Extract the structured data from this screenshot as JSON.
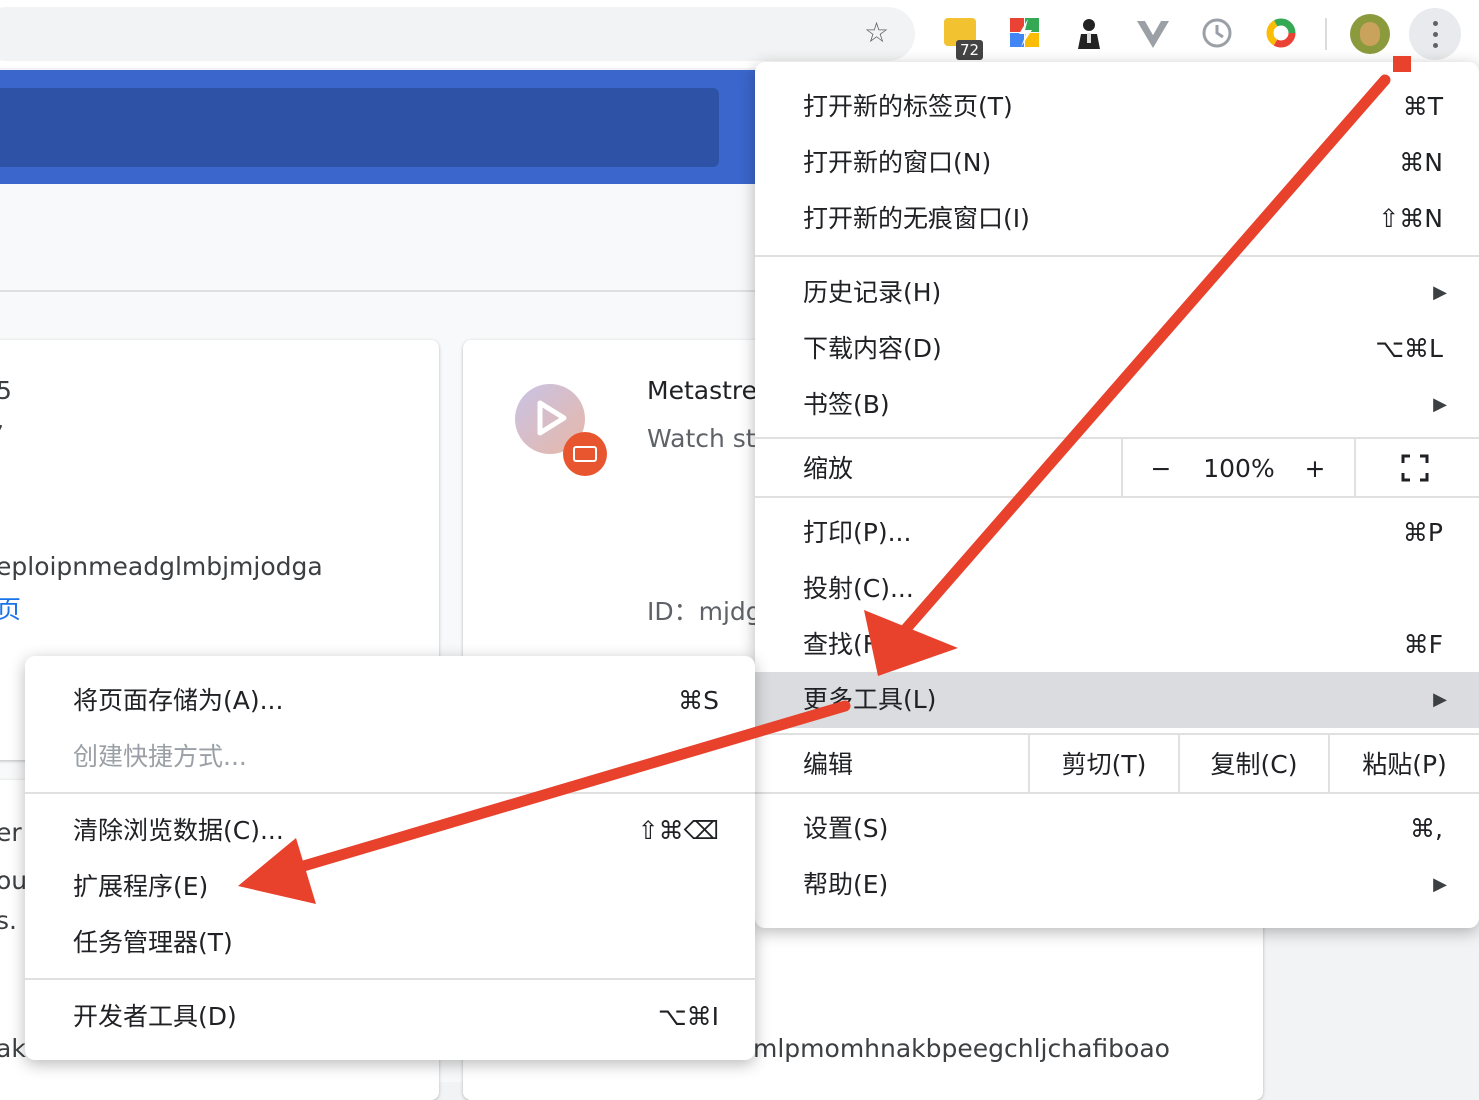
{
  "toolbar": {
    "extension_badge": "72"
  },
  "page": {
    "card1": {
      "line1": "5",
      "line2": "’",
      "id_tail": "eploipnmeadglmbjmjodga",
      "link_tail": "页"
    },
    "card2": {
      "name": "Metastrea",
      "desc": "Watch str",
      "id": "ID：mjdg"
    },
    "card3": {
      "line1": "er T",
      "line2": "oug",
      "line3": "s."
    },
    "card_bottom": {
      "left_tail": "ak",
      "id": "mlpmomhnakbpeegchljchafiboao"
    }
  },
  "chrome_menu": {
    "new_tab": {
      "label": "打开新的标签页(T)",
      "shortcut": "⌘T"
    },
    "new_window": {
      "label": "打开新的窗口(N)",
      "shortcut": "⌘N"
    },
    "incognito": {
      "label": "打开新的无痕窗口(I)",
      "shortcut": "⇧⌘N"
    },
    "history": {
      "label": "历史记录(H)"
    },
    "downloads": {
      "label": "下载内容(D)",
      "shortcut": "⌥⌘L"
    },
    "bookmarks": {
      "label": "书签(B)"
    },
    "zoom": {
      "label": "缩放",
      "minus": "−",
      "value": "100%",
      "plus": "+"
    },
    "print": {
      "label": "打印(P)...",
      "shortcut": "⌘P"
    },
    "cast": {
      "label": "投射(C)..."
    },
    "find": {
      "label": "查找(F)",
      "shortcut": "⌘F"
    },
    "more_tools": {
      "label": "更多工具(L)"
    },
    "edit": {
      "label": "编辑",
      "cut": "剪切(T)",
      "copy": "复制(C)",
      "paste": "粘贴(P)"
    },
    "settings": {
      "label": "设置(S)",
      "shortcut": "⌘,"
    },
    "help": {
      "label": "帮助(E)"
    }
  },
  "more_tools_menu": {
    "save_page": {
      "label": "将页面存储为(A)...",
      "shortcut": "⌘S"
    },
    "create_shortcut": {
      "label": "创建快捷方式..."
    },
    "clear_data": {
      "label": "清除浏览数据(C)...",
      "shortcut": "⇧⌘⌫"
    },
    "extensions": {
      "label": "扩展程序(E)"
    },
    "task_manager": {
      "label": "任务管理器(T)"
    },
    "dev_tools": {
      "label": "开发者工具(D)",
      "shortcut": "⌥⌘I"
    }
  },
  "colors": {
    "annotation_arrow": "#e8412c",
    "header_blue": "#3b66cc",
    "menu_highlight": "#dadce0"
  }
}
